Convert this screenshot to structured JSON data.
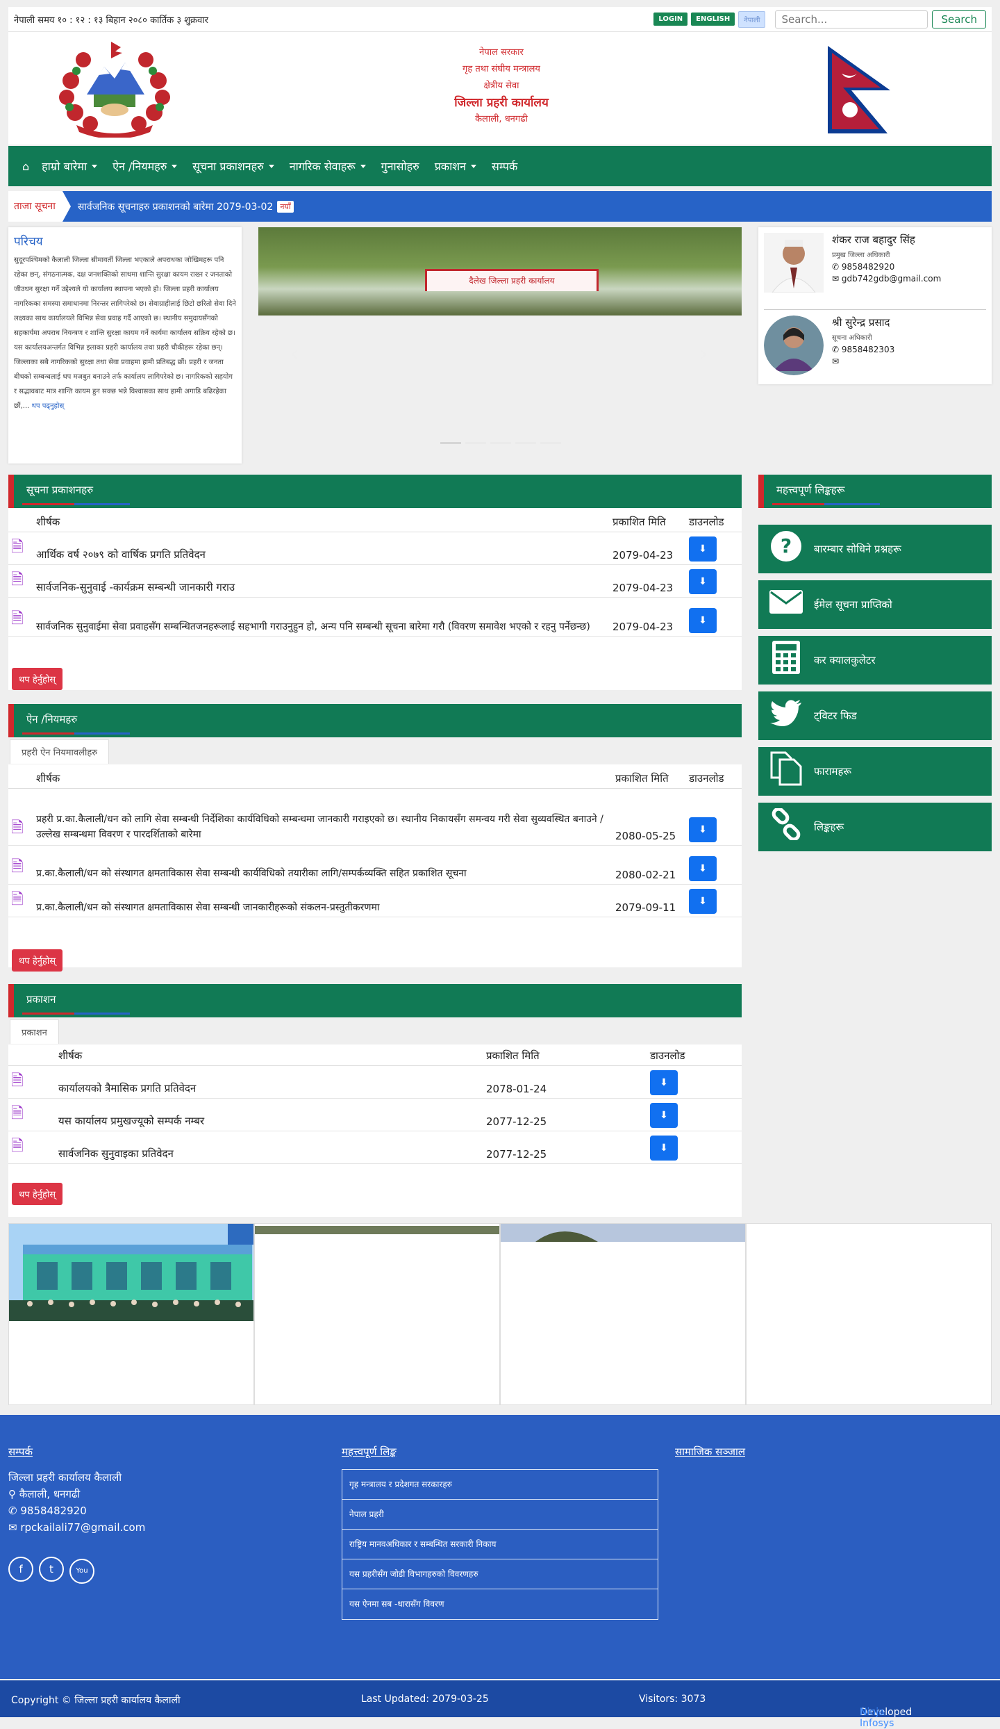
{
  "topbar": {
    "time": "नेपाली समय १० : १२ : १३ बिहान   २०८० कार्तिक ३ शुक्रवार",
    "login": "LOGIN",
    "english": "ENGLISH",
    "nepali": "नेपाली",
    "search_placeholder": "Search...",
    "search_label": "Search"
  },
  "header": {
    "line1": "नेपाल सरकार",
    "line2": "गृह तथा संघीय मन्त्रालय",
    "line3": "क्षेत्रीय सेवा",
    "line4": "जिल्ला प्रहरी कार्यालय",
    "line5": "कैलाली, धनगढी"
  },
  "nav": {
    "home_icon": "home-icon",
    "items": [
      "हाम्रो बारेमा",
      "ऐन /नियमहरु",
      "सूचना प्रकाशनहरु",
      "नागरिक सेवाहरू",
      "गुनासोहरु",
      "प्रकाशन",
      "सम्पर्क"
    ]
  },
  "ticker": {
    "label": "ताजा सूचना",
    "text": "सार्वजनिक सूचनाहरु प्रकाशनको बारेमा 2079-03-02",
    "badge": "नयाँ"
  },
  "intro": {
    "title": "परिचय",
    "body": "सुदूरपश्चिमको कैलाली जिल्ला सीमावर्ती जिल्ला भएकाले अपराधका जोखिमहरू पनि रहेका छन्, संगठनात्मक, दक्ष जनशक्तिको साथमा शान्ति सुरक्षा कायम राख्न र जनताको जीउधन सुरक्षा गर्ने उद्देश्यले यो कार्यालय स्थापना भएको हो। जिल्ला प्रहरी कार्यालय नागरिकका समस्या समाधानमा निरन्तर लागिपरेको छ। सेवाग्राहीलाई छिटो छरितो सेवा दिने लक्ष्यका साथ कार्यालयले विभिन्न सेवा प्रवाह गर्दै आएको छ। स्थानीय समुदायसँगको सहकार्यमा अपराध नियन्त्रण र शान्ति सुरक्षा कायम गर्ने कार्यमा कार्यालय सक्रिय रहेको छ। यस कार्यालयअन्तर्गत विभिन्न इलाका प्रहरी कार्यालय तथा प्रहरी चौकीहरू रहेका छन्। जिल्लाका सबै नागरिकको सुरक्षा तथा सेवा प्रवाहमा हामी प्रतिबद्ध छौं। प्रहरी र जनता बीचको सम्बन्धलाई थप मजबुत बनाउने तर्फ कार्यालय लागिपरेको छ। नागरिकको सहयोग र सद्भावबाट मात्र शान्ति कायम हुन सक्छ भन्ने विश्वासका साथ हामी अगाडि बढिरहेका छौं,",
    "more": "थप पढ्नुहोस्"
  },
  "slider": {
    "banner": "दैलेख जिल्ला प्रहरी कार्यालय",
    "prev": "‹",
    "next": "›"
  },
  "staff": [
    {
      "name": "शंकर राज बहादुर सिंह",
      "position": "प्रमुख जिल्ला अधिकारी",
      "phone": "9858482920",
      "email": "gdb742gdb@gmail.com"
    },
    {
      "name": "श्री सुरेन्द्र प्रसाद",
      "position": "सूचना अधिकारी",
      "phone": "9858482303",
      "email": ""
    }
  ],
  "notices": {
    "title": "सूचना प्रकाशनहरु",
    "col_title": "शीर्षक",
    "col_date": "प्रकाशित मिति",
    "col_dl": "डाउनलोड",
    "rows": [
      {
        "title": "आर्थिक वर्ष २०७९ को वार्षिक प्रगति प्रतिवेदन",
        "date": "2079-04-23"
      },
      {
        "title": "सार्वजनिक-सुनुवाई -कार्यक्रम सम्बन्धी जानकारी गराउ",
        "date": "2079-04-23"
      },
      {
        "title": "सार्वजनिक सुनुवाईमा सेवा प्रवाहसँग सम्बन्धितजनहरूलाई सहभागी गराउनुहुन हो, अन्य पनि सम्बन्धी सूचना बारेमा गरौ (विवरण समावेश भएको र रहनु पर्नेछन्छ)",
        "date": "2079-04-23"
      }
    ],
    "more": "थप हेर्नुहोस्"
  },
  "acts": {
    "title": "ऐन /नियमहरु",
    "tab": "प्रहरी ऐन नियमावलीहरु",
    "col_title": "शीर्षक",
    "col_date": "प्रकाशित मिति",
    "col_dl": "डाउनलोड",
    "rows": [
      {
        "title": "प्रहरी प्र.का.कैलाली/धन को लागि सेवा सम्बन्धी निर्देशिका कार्यविधिको सम्बन्धमा जानकारी गराइएको छ। स्थानीय निकायसँग समन्वय गरी सेवा सुव्यवस्थित बनाउने / उल्लेख सम्बन्धमा विवरण र पारदर्शिताको बारेमा",
        "date": "2080-05-25"
      },
      {
        "title": "प्र.का.कैलाली/धन को संस्थागत क्षमताविकास सेवा सम्बन्धी कार्यविधिको तयारीका लागि/सम्पर्कव्यक्ति सहित प्रकाशित सूचना",
        "date": "2080-02-21"
      },
      {
        "title": "प्र.का.कैलाली/धन को संस्थागत क्षमताविकास सेवा सम्बन्धी जानकारीहरूको संकलन-प्रस्तुतीकरणमा",
        "date": "2079-09-11"
      }
    ],
    "more": "थप हेर्नुहोस्"
  },
  "pubs": {
    "title": "प्रकाशन",
    "tab": "प्रकाशन",
    "col_title": "शीर्षक",
    "col_date": "प्रकाशित मिति",
    "col_dl": "डाउनलोड",
    "rows": [
      {
        "title": "कार्यालयको त्रैमासिक प्रगति प्रतिवेदन",
        "date": "2078-01-24"
      },
      {
        "title": "यस कार्यालय प्रमुखज्यूको सम्पर्क नम्बर",
        "date": "2077-12-25"
      },
      {
        "title": "सार्वजनिक सुनुवाइका प्रतिवेदन",
        "date": "2077-12-25"
      }
    ],
    "more": "थप हेर्नुहोस्"
  },
  "quick": {
    "title": "महत्त्वपूर्ण लिङ्कहरू",
    "items": [
      {
        "icon": "question-icon",
        "label": "बारम्बार सोधिने प्रश्नहरू"
      },
      {
        "icon": "mail-icon",
        "label": "ईमेल सूचना प्राप्तिको"
      },
      {
        "icon": "calculator-icon",
        "label": "कर क्यालकुलेटर"
      },
      {
        "icon": "twitter-icon",
        "label": "ट्विटर फिड"
      },
      {
        "icon": "documents-icon",
        "label": "फारामहरू"
      },
      {
        "icon": "link-icon",
        "label": "लिङ्कहरू"
      }
    ]
  },
  "footer": {
    "contact_title": "सम्पर्क",
    "office": "जिल्ला प्रहरी कार्यालय कैलाली",
    "address": "कैलाली, धनगढी",
    "phone": "9858482920",
    "email": "rpckailali77@gmail.com",
    "links_title": "महत्त्वपूर्ण लिङ्क",
    "links": [
      "गृह मन्त्रालय र प्रदेशगत सरकारहरु",
      "नेपाल प्रहरी",
      "राष्ट्रिय मानवअधिकार र सम्बन्धित सरकारी निकाय",
      "यस प्रहरीसँग जोडी विभागहरुको विवरणहरु",
      "यस ऐनमा सब -धारासँग विवरण"
    ],
    "social_title": "सामाजिक सञ्जाल",
    "yt": "You"
  },
  "copyright": {
    "text": "Copyright © जिल्ला प्रहरी कार्यालय कैलाली",
    "updated": "Last Updated: 2079-03-25",
    "visitors": "Visitors: 3073",
    "developed": "Developed By:",
    "dev_name": "Ninja Infosys"
  },
  "colors": {
    "green": "#117a55",
    "blue": "#2b5ec1",
    "red": "#d0282c"
  }
}
